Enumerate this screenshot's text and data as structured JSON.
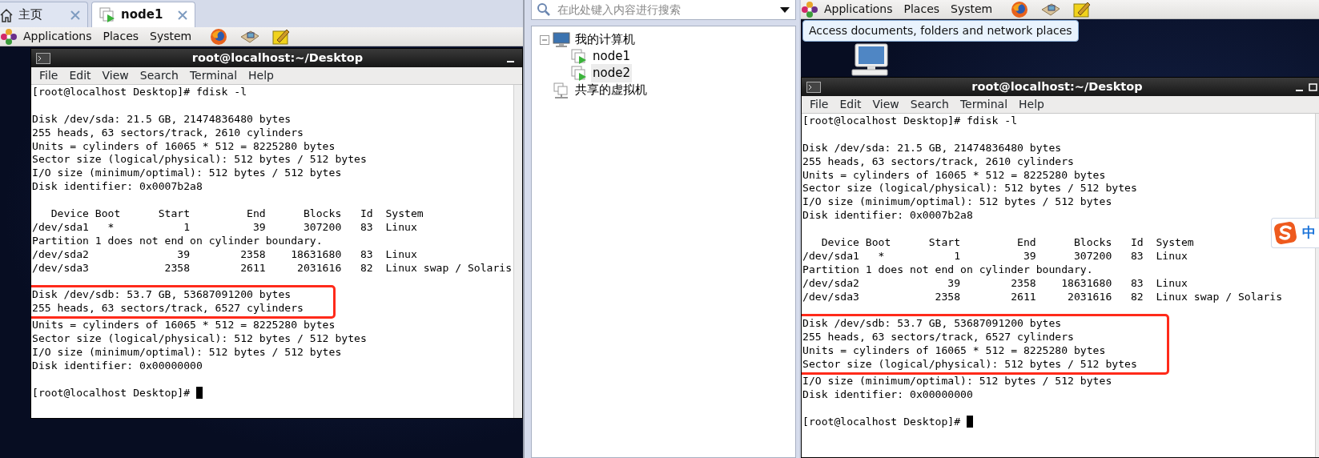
{
  "left_pane": {
    "tabs": [
      {
        "label": "主页",
        "kind": "home",
        "selected": false
      },
      {
        "label": "node1",
        "kind": "vm",
        "selected": true
      }
    ],
    "panel_menu": [
      "Applications",
      "Places",
      "System"
    ],
    "terminal": {
      "title": "root@localhost:~/Desktop",
      "menu": [
        "File",
        "Edit",
        "View",
        "Search",
        "Terminal",
        "Help"
      ],
      "blocks": [
        {
          "lines": [
            {
              "text": "[root@localhost Desktop]# fdisk -l",
              "highlighted": false
            }
          ]
        },
        {
          "lines": [
            {
              "text": "Disk /dev/sda: 21.5 GB, 21474836480 bytes",
              "highlighted": false
            },
            {
              "text": "255 heads, 63 sectors/track, 2610 cylinders",
              "highlighted": false
            },
            {
              "text": "Units = cylinders of 16065 * 512 = 8225280 bytes",
              "highlighted": false
            },
            {
              "text": "Sector size (logical/physical): 512 bytes / 512 bytes",
              "highlighted": false
            },
            {
              "text": "I/O size (minimum/optimal): 512 bytes / 512 bytes",
              "highlighted": false
            },
            {
              "text": "Disk identifier: 0x0007b2a8",
              "highlighted": false
            }
          ]
        },
        {
          "lines": [
            {
              "text": "   Device Boot      Start         End      Blocks   Id  System",
              "highlighted": false
            },
            {
              "text": "/dev/sda1   *           1          39      307200   83  Linux",
              "highlighted": false
            },
            {
              "text": "Partition 1 does not end on cylinder boundary.",
              "highlighted": false
            },
            {
              "text": "/dev/sda2              39        2358    18631680   83  Linux",
              "highlighted": false
            },
            {
              "text": "/dev/sda3            2358        2611     2031616   82  Linux swap / Solaris",
              "highlighted": false
            }
          ]
        },
        {
          "lines": [
            {
              "text": "Disk /dev/sdb: 53.7 GB, 53687091200 bytes",
              "highlighted": true
            },
            {
              "text": "255 heads, 63 sectors/track, 6527 cylinders",
              "highlighted": true
            },
            {
              "text": "Units = cylinders of 16065 * 512 = 8225280 bytes",
              "highlighted": false
            },
            {
              "text": "Sector size (logical/physical): 512 bytes / 512 bytes",
              "highlighted": false
            },
            {
              "text": "I/O size (minimum/optimal): 512 bytes / 512 bytes",
              "highlighted": false
            },
            {
              "text": "Disk identifier: 0x00000000",
              "highlighted": false
            }
          ]
        },
        {
          "lines": [
            {
              "text": "[root@localhost Desktop]#",
              "highlighted": false,
              "cursor": true
            }
          ]
        }
      ]
    }
  },
  "vm_library": {
    "search": {
      "placeholder": "在此处键入内容进行搜索"
    },
    "tree": [
      {
        "label": "我的计算机",
        "kind": "computer",
        "selected": false,
        "expanded": true,
        "children": [
          {
            "label": "node1",
            "kind": "vm",
            "selected": false
          },
          {
            "label": "node2",
            "kind": "vm",
            "selected": true
          }
        ]
      },
      {
        "label": "共享的虚拟机",
        "kind": "shared",
        "selected": false
      }
    ]
  },
  "right_pane": {
    "panel_menu": [
      "Applications",
      "Places",
      "System"
    ],
    "tooltip": "Access documents, folders and network places",
    "terminal": {
      "title": "root@localhost:~/Desktop",
      "menu": [
        "File",
        "Edit",
        "View",
        "Search",
        "Terminal",
        "Help"
      ],
      "blocks": [
        {
          "lines": [
            {
              "text": "[root@localhost Desktop]# fdisk -l",
              "highlighted": false
            }
          ]
        },
        {
          "lines": [
            {
              "text": "Disk /dev/sda: 21.5 GB, 21474836480 bytes",
              "highlighted": false
            },
            {
              "text": "255 heads, 63 sectors/track, 2610 cylinders",
              "highlighted": false
            },
            {
              "text": "Units = cylinders of 16065 * 512 = 8225280 bytes",
              "highlighted": false
            },
            {
              "text": "Sector size (logical/physical): 512 bytes / 512 bytes",
              "highlighted": false
            },
            {
              "text": "I/O size (minimum/optimal): 512 bytes / 512 bytes",
              "highlighted": false
            },
            {
              "text": "Disk identifier: 0x0007b2a8",
              "highlighted": false
            }
          ]
        },
        {
          "lines": [
            {
              "text": "   Device Boot      Start         End      Blocks   Id  System",
              "highlighted": false
            },
            {
              "text": "/dev/sda1   *           1          39      307200   83  Linux",
              "highlighted": false
            },
            {
              "text": "Partition 1 does not end on cylinder boundary.",
              "highlighted": false
            },
            {
              "text": "/dev/sda2              39        2358    18631680   83  Linux",
              "highlighted": false
            },
            {
              "text": "/dev/sda3            2358        2611     2031616   82  Linux swap / Solaris",
              "highlighted": false
            }
          ]
        },
        {
          "lines": [
            {
              "text": "Disk /dev/sdb: 53.7 GB, 53687091200 bytes",
              "highlighted": true
            },
            {
              "text": "255 heads, 63 sectors/track, 6527 cylinders",
              "highlighted": true
            },
            {
              "text": "Units = cylinders of 16065 * 512 = 8225280 bytes",
              "highlighted": true
            },
            {
              "text": "Sector size (logical/physical): 512 bytes / 512 bytes",
              "highlighted": true
            },
            {
              "text": "I/O size (minimum/optimal): 512 bytes / 512 bytes",
              "highlighted": false
            },
            {
              "text": "Disk identifier: 0x00000000",
              "highlighted": false
            }
          ]
        },
        {
          "lines": [
            {
              "text": "[root@localhost Desktop]#",
              "highlighted": false,
              "cursor": true
            }
          ]
        }
      ]
    },
    "ime": {
      "mode": "中"
    }
  }
}
